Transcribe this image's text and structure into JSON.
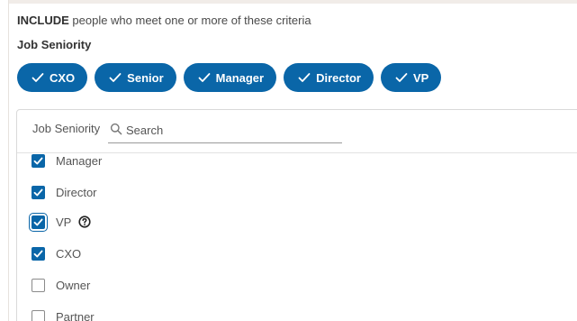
{
  "header": {
    "include_strong": "INCLUDE",
    "include_rest": " people who meet one or more of these criteria"
  },
  "section": {
    "title": "Job Seniority"
  },
  "chips": [
    {
      "label": "CXO",
      "icon": "check-icon"
    },
    {
      "label": "Senior",
      "icon": "check-icon"
    },
    {
      "label": "Manager",
      "icon": "check-icon"
    },
    {
      "label": "Director",
      "icon": "check-icon"
    },
    {
      "label": "VP",
      "icon": "check-icon"
    }
  ],
  "panel": {
    "label": "Job Seniority",
    "search": {
      "placeholder": "Search",
      "value": "",
      "icon": "search-icon"
    },
    "options": [
      {
        "label": "Manager",
        "checked": true
      },
      {
        "label": "Director",
        "checked": true
      },
      {
        "label": "VP",
        "checked": true,
        "focused": true,
        "help_icon": "help-circle-icon"
      },
      {
        "label": "CXO",
        "checked": true
      },
      {
        "label": "Owner",
        "checked": false
      },
      {
        "label": "Partner",
        "checked": false
      }
    ]
  },
  "colors": {
    "accent": "#0a66a8",
    "text": "#555555",
    "border": "#d9d9d9"
  }
}
